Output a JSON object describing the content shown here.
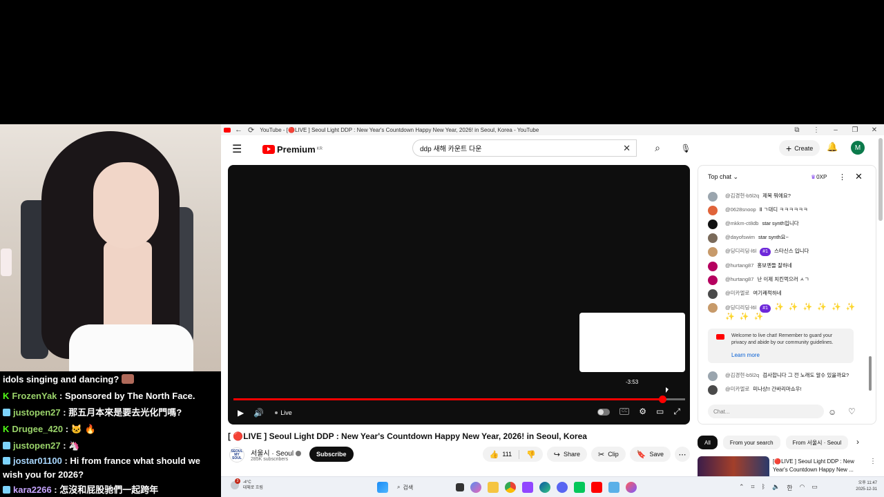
{
  "browser": {
    "window_title": "YouTube - [🔴LIVE ] Seoul Light DDP : New Year's Countdown Happy New Year, 2026! in Seoul, Korea - YouTube"
  },
  "youtube": {
    "logo_text": "Premium",
    "region": "KR",
    "search_value": "ddp 새해 카운트 다운",
    "create_label": "Create",
    "avatar_letter": "M"
  },
  "player": {
    "time_hint": "-3:53",
    "live_label": "Live",
    "progress_fraction": 0.95
  },
  "video": {
    "title": "[ 🔴LIVE ] Seoul Light DDP : New Year's Countdown Happy New Year, 2026! in Seoul, Korea",
    "channel_name": "서울시 · Seoul",
    "subscribers": "285K subscribers",
    "subscribe_label": "Subscribe",
    "likes": "111",
    "share_label": "Share",
    "clip_label": "Clip",
    "save_label": "Save",
    "channel_logo_text": "SEOUL MY SOUL"
  },
  "livechat": {
    "mode": "Top chat",
    "xp": "0XP",
    "messages": [
      {
        "author": "@김경현-b5l2q",
        "text": "제목 뭐에요?",
        "color": "#9aa5ae"
      },
      {
        "author": "@0628snoop",
        "text": "Ⅱ ㄱ대디 ㅋㅋㅋㅋㅋㅋ",
        "color": "#e0643a"
      },
      {
        "author": "@mkkm-ct8db",
        "text": "star synth입니다",
        "color": "#111111"
      },
      {
        "author": "@dayofswim",
        "text": "star synth요~",
        "color": "#7a6a5a"
      },
      {
        "author": "@딩디리딩-l6l",
        "badge": "#1",
        "text": "스타신스 입니다",
        "color": "#c79a6a"
      },
      {
        "author": "@hurtang87",
        "text": "홍보멘들 잘하네",
        "color": "#b5005f"
      },
      {
        "author": "@hurtang87",
        "text": "난 이제 치킨먹으러 ㅅㄱ",
        "color": "#b5005f"
      },
      {
        "author": "@미카엘로",
        "text": "여기쾌적하네",
        "color": "#4a4a4a"
      },
      {
        "author": "@딩디리딩-l6l",
        "badge": "#1",
        "text": "✨ ✨ ✨ ✨ ✨ ✨ ✨ ✨ ✨",
        "color": "#c79a6a"
      }
    ],
    "welcome_text": "Welcome to live chat! Remember to guard your privacy and abide by our community guidelines.",
    "learn_more": "Learn more",
    "messages_after": [
      {
        "author": "@김경현-b5l2q",
        "text": "검사합니다 그 전 노래도 알수 있을까요?",
        "color": "#9aa5ae"
      },
      {
        "author": "@미카엘로",
        "text": "미나상!! 간바리마쇼우!",
        "color": "#4a4a4a"
      }
    ],
    "input_placeholder": "Chat..."
  },
  "chips": [
    "All",
    "From your search",
    "From 서울시 · Seoul"
  ],
  "recommendation": {
    "title": "[🔴LIVE ] Seoul Light DDP : New Year's Countdown Happy New ..."
  },
  "taskbar": {
    "weather_temp": "-4°C",
    "weather_desc": "대체로 흐림",
    "search_label": "검색",
    "ime": "한",
    "time": "오후 11:47",
    "date": "2025-12-31",
    "notif_count": "3"
  },
  "stream_chat": [
    {
      "user": "",
      "text": "idols singing and dancing?"
    },
    {
      "user": "FrozenYak",
      "text": ": Sponsored by The North Face."
    },
    {
      "user": "justopen27",
      "text": ": 那五月本來是要去光化門嗎?"
    },
    {
      "user": "Drugee_420",
      "text": ":"
    },
    {
      "user": "justopen27",
      "text": ":"
    },
    {
      "user": "jostar01100",
      "text": ": Hi from france what should we wish you for 2026?"
    },
    {
      "user": "kara2266",
      "text": ": 怎沒和屁股驰們一起跨年"
    }
  ]
}
